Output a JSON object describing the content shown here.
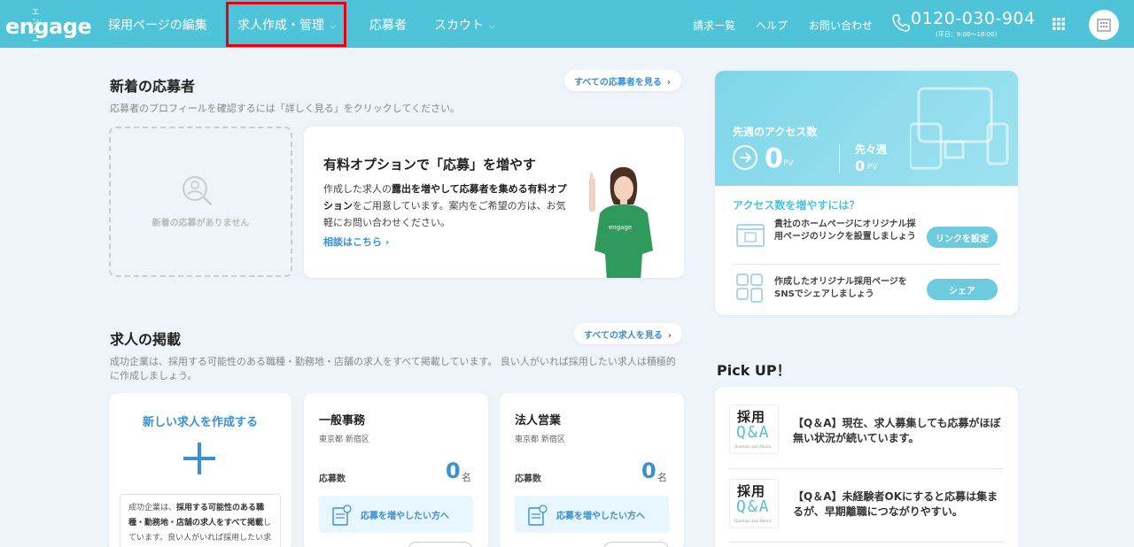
{
  "header": {
    "logo_small": "エンゲージ",
    "logo": "engage",
    "nav": [
      {
        "label": "採用ページの編集"
      },
      {
        "label": "求人作成・管理"
      },
      {
        "label": "応募者"
      },
      {
        "label": "スカウト"
      }
    ],
    "right_nav": [
      "請求一覧",
      "ヘルプ",
      "お問い合わせ"
    ],
    "phone": "0120-030-904",
    "phone_hours": "(平日：9:00〜18:00)"
  },
  "applicants": {
    "title": "新着の応募者",
    "description": "応募者のプロフィールを確認するには「詳しく見る」をクリックしてください。",
    "see_all": "すべての応募者を見る",
    "empty_text": "新着の応募がありません"
  },
  "promo": {
    "title": "有料オプションで「応募」を増やす",
    "body_1": "作成した求人の",
    "body_bold": "露出を増やして応募者を集める有料オプション",
    "body_2": "をご用意しています。案内をご希望の方は、お気軽にお問い合わせください。",
    "link": "相談はこちら"
  },
  "access": {
    "label": "先週のアクセス数",
    "value": "0",
    "unit": "PV",
    "prev_label": "先々週",
    "prev_value": "0",
    "prev_unit": "PV",
    "increase_title": "アクセス数を増やすには？",
    "tips": [
      {
        "text": "貴社のホームページにオリジナル採用ページのリンクを設置しましょう",
        "button": "リンクを設定"
      },
      {
        "text": "作成したオリジナル採用ページをSNSでシェアしましょう",
        "button": "シェア"
      }
    ]
  },
  "jobs": {
    "title": "求人の掲載",
    "description": "成功企業は、採用する可能性のある職種・勤務地・店舗の求人をすべて掲載しています。 良い人がいれば採用したい求人は積極的に作成しましょう。",
    "see_all": "すべての求人を見る",
    "new_title": "新しい求人を作成する",
    "new_desc_1": "成功企業は、",
    "new_desc_bold": "採用する可能性のある職種・勤務地・店舗の求人をすべて掲載",
    "new_desc_2": "しています。良い人がいれば採用したい求人は積極的に作成しましょう。",
    "list": [
      {
        "title": "一般事務",
        "location": "東京都 新宿区",
        "applicants_label": "応募数",
        "count": "0",
        "unit": "名",
        "boost": "応募を増やしたい方へ"
      },
      {
        "title": "法人営業",
        "location": "東京都 新宿区",
        "applicants_label": "応募数",
        "count": "0",
        "unit": "名",
        "boost": "応募を増やしたい方へ"
      }
    ]
  },
  "pickup": {
    "title": "Pick UP！",
    "logo_text": "採用",
    "logo_qa": "Q&A",
    "logo_sub": "Question and Advice",
    "items": [
      {
        "text": "【Q＆A】現在、求人募集しても応募がほぼ無い状況が続いています。"
      },
      {
        "text": "【Q＆A】未経験者OKにすると応募は集まるが、早期離職につながりやすい。"
      }
    ]
  },
  "colors": {
    "header": "#4fc3d7",
    "accent": "#3a8fd6",
    "highlight": "#e60012"
  }
}
